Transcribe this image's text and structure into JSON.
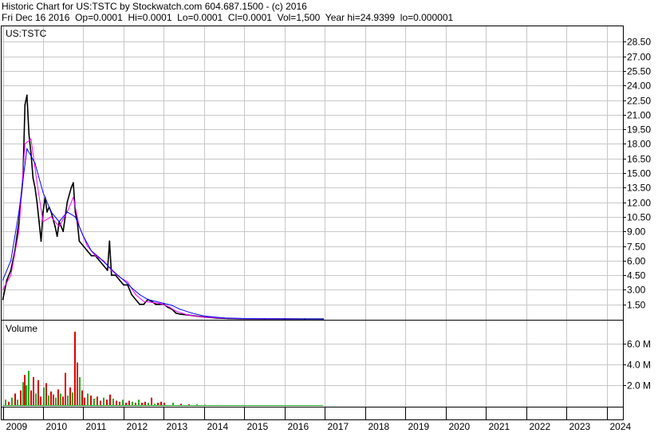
{
  "header": {
    "line1": "Historic Chart for US:TSTC by Stockwatch.com 604.687.1500 - (c) 2016",
    "date": "Fri Dec 16 2016",
    "open": "Op=0.0001",
    "high": "Hi=0.0001",
    "low": "Lo=0.0001",
    "close": "Cl=0.0001",
    "volume": "Vol=1,500",
    "year_high": "Year hi=24.9399",
    "year_low": "lo=0.000001"
  },
  "chart_data": [
    {
      "type": "line",
      "panel": "price",
      "title": "US:TSTC",
      "ylim": [
        0,
        30
      ],
      "yticks": [
        "1.50",
        "3.00",
        "4.50",
        "6.00",
        "7.50",
        "9.00",
        "10.50",
        "12.00",
        "13.50",
        "15.00",
        "16.50",
        "18.00",
        "19.50",
        "21.00",
        "22.50",
        "24.00",
        "25.50",
        "27.00",
        "28.50"
      ],
      "xlabels": [
        "2009",
        "2010",
        "2011",
        "2012",
        "2013",
        "2014",
        "2015",
        "2016",
        "2017",
        "2018",
        "2019",
        "2020",
        "2021",
        "2022",
        "2023",
        "2024"
      ],
      "xlim": [
        2008.97,
        2024.4
      ],
      "grid": true,
      "series": [
        {
          "color": "#000000",
          "x": [
            2009.0,
            2009.1,
            2009.2,
            2009.3,
            2009.4,
            2009.5,
            2009.55,
            2009.6,
            2009.65,
            2009.7,
            2009.75,
            2009.8,
            2009.85,
            2009.9,
            2009.95,
            2010.0,
            2010.05,
            2010.1,
            2010.15,
            2010.2,
            2010.3,
            2010.35,
            2010.4,
            2010.5,
            2010.6,
            2010.7,
            2010.75,
            2010.8,
            2010.85,
            2010.9,
            2011.0,
            2011.1,
            2011.2,
            2011.3,
            2011.4,
            2011.5,
            2011.6,
            2011.65,
            2011.7,
            2011.8,
            2011.9,
            2012.0,
            2012.1,
            2012.2,
            2012.3,
            2012.4,
            2012.5,
            2012.6,
            2012.7,
            2012.8,
            2012.9,
            2013.0,
            2013.1,
            2013.2,
            2013.3,
            2013.4,
            2013.6,
            2013.8,
            2014.0,
            2014.3,
            2014.6,
            2015.0,
            2015.5,
            2016.0,
            2016.5,
            2016.96
          ],
          "values": [
            2.0,
            4.0,
            5.0,
            7.0,
            10.0,
            14.5,
            22.0,
            23.0,
            19.0,
            17.0,
            14.5,
            13.5,
            12.0,
            10.0,
            8.0,
            11.0,
            12.5,
            11.0,
            11.5,
            11.0,
            9.5,
            8.5,
            10.0,
            9.0,
            12.0,
            13.5,
            14.0,
            11.0,
            10.0,
            8.0,
            7.5,
            7.0,
            6.5,
            6.5,
            6.0,
            5.5,
            5.0,
            8.0,
            4.5,
            4.5,
            4.0,
            3.5,
            3.5,
            2.5,
            2.0,
            1.5,
            1.5,
            2.0,
            1.8,
            1.5,
            1.5,
            1.5,
            1.2,
            1.0,
            0.6,
            0.5,
            0.4,
            0.3,
            0.2,
            0.1,
            0.05,
            0.02,
            0.01,
            0.005,
            0.002,
            0.0001
          ]
        },
        {
          "color": "#ff00ff",
          "x": [
            2009.0,
            2009.2,
            2009.4,
            2009.55,
            2009.7,
            2009.85,
            2010.0,
            2010.2,
            2010.4,
            2010.6,
            2010.75,
            2010.9,
            2011.1,
            2011.3,
            2011.5,
            2011.7,
            2011.9,
            2012.1,
            2012.3,
            2012.5,
            2012.7,
            2012.9,
            2013.1,
            2013.3,
            2013.6,
            2014.0,
            2014.5,
            2015.0,
            2016.0,
            2016.96
          ],
          "values": [
            3.0,
            4.5,
            9.0,
            18.0,
            18.5,
            14.0,
            10.0,
            10.5,
            9.5,
            11.0,
            12.5,
            9.5,
            7.5,
            6.5,
            6.0,
            5.0,
            4.3,
            3.8,
            2.5,
            1.8,
            1.7,
            1.6,
            1.3,
            0.8,
            0.4,
            0.2,
            0.08,
            0.03,
            0.01,
            0.0001
          ]
        },
        {
          "color": "#0000ff",
          "x": [
            2009.0,
            2009.2,
            2009.4,
            2009.6,
            2009.8,
            2010.0,
            2010.2,
            2010.4,
            2010.6,
            2010.8,
            2011.0,
            2011.2,
            2011.4,
            2011.6,
            2011.8,
            2012.0,
            2012.2,
            2012.4,
            2012.6,
            2012.8,
            2013.0,
            2013.2,
            2013.4,
            2013.7,
            2014.0,
            2014.5,
            2015.0,
            2016.0,
            2016.96
          ],
          "values": [
            4.0,
            6.0,
            11.0,
            17.5,
            16.0,
            13.0,
            11.0,
            10.0,
            11.0,
            10.5,
            8.5,
            7.0,
            6.3,
            5.5,
            4.7,
            4.0,
            3.2,
            2.5,
            2.0,
            1.8,
            1.6,
            1.4,
            1.0,
            0.6,
            0.3,
            0.1,
            0.04,
            0.01,
            0.0001
          ]
        }
      ]
    },
    {
      "type": "bar",
      "panel": "volume",
      "title": "Volume",
      "ylim": [
        0,
        8.2
      ],
      "yticks": [
        "2.0 M",
        "4.0 M",
        "6.0 M"
      ],
      "up_color": "#22aa22",
      "down_color": "#dd0000",
      "x": [
        2009.05,
        2009.12,
        2009.2,
        2009.28,
        2009.35,
        2009.42,
        2009.48,
        2009.52,
        2009.56,
        2009.62,
        2009.68,
        2009.74,
        2009.8,
        2009.86,
        2009.92,
        2010.0,
        2010.06,
        2010.12,
        2010.18,
        2010.24,
        2010.3,
        2010.36,
        2010.42,
        2010.48,
        2010.54,
        2010.6,
        2010.66,
        2010.72,
        2010.78,
        2010.84,
        2010.9,
        2010.96,
        2011.02,
        2011.08,
        2011.16,
        2011.24,
        2011.32,
        2011.4,
        2011.48,
        2011.56,
        2011.64,
        2011.72,
        2011.8,
        2011.88,
        2011.96,
        2012.04,
        2012.12,
        2012.2,
        2012.28,
        2012.36,
        2012.44,
        2012.52,
        2012.6,
        2012.68,
        2012.76,
        2012.84,
        2012.92,
        2013.0,
        2013.2,
        2013.4,
        2013.6,
        2013.8,
        2014.0,
        2014.3,
        2014.6,
        2015.0,
        2015.5,
        2016.0,
        2016.5
      ],
      "values": [
        0.6,
        0.4,
        0.8,
        1.2,
        0.6,
        1.5,
        2.3,
        3.0,
        2.0,
        3.4,
        1.5,
        2.8,
        1.2,
        2.5,
        0.9,
        1.8,
        2.2,
        1.0,
        1.4,
        1.1,
        0.8,
        1.6,
        1.2,
        0.9,
        3.2,
        1.0,
        1.8,
        1.3,
        7.2,
        4.2,
        2.8,
        1.5,
        0.8,
        1.2,
        1.0,
        0.7,
        0.9,
        0.5,
        0.8,
        0.6,
        1.1,
        0.7,
        0.5,
        0.4,
        0.6,
        0.3,
        0.5,
        0.4,
        0.3,
        0.6,
        0.3,
        0.4,
        0.3,
        0.8,
        0.2,
        0.3,
        0.4,
        0.3,
        0.3,
        0.2,
        0.15,
        0.15,
        0.1,
        0.08,
        0.06,
        0.05,
        0.04,
        0.03,
        0.02
      ],
      "up": [
        true,
        false,
        true,
        false,
        true,
        false,
        true,
        false,
        true,
        true,
        false,
        false,
        true,
        false,
        false,
        true,
        false,
        true,
        false,
        false,
        true,
        false,
        true,
        false,
        false,
        true,
        false,
        true,
        false,
        false,
        true,
        false,
        false,
        true,
        false,
        true,
        false,
        false,
        true,
        false,
        false,
        true,
        false,
        false,
        true,
        false,
        false,
        true,
        false,
        true,
        false,
        false,
        true,
        false,
        true,
        false,
        false,
        false,
        true,
        false,
        false,
        true,
        false,
        false,
        true,
        false,
        false,
        false,
        true
      ]
    }
  ]
}
